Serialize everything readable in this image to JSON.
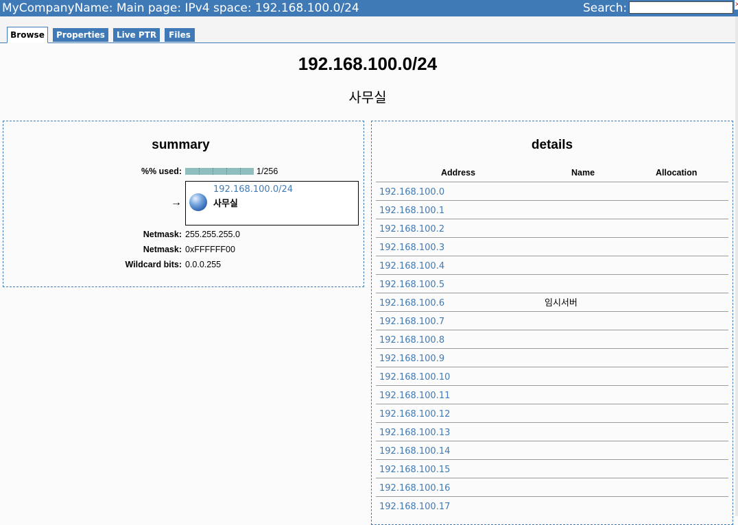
{
  "header": {
    "title": "MyCompanyName: Main page: IPv4 space: 192.168.100.0/24",
    "search_label": "Search:",
    "search_value": ""
  },
  "tabs": [
    {
      "label": "Browse",
      "active": true
    },
    {
      "label": "Properties",
      "active": false
    },
    {
      "label": "Live PTR",
      "active": false
    },
    {
      "label": "Files",
      "active": false
    }
  ],
  "page": {
    "title": "192.168.100.0/24",
    "subtitle": "사무실"
  },
  "summary": {
    "title": "summary",
    "used_label": "%% used:",
    "used_value": "1/256",
    "used_fraction": 0.0039,
    "network": {
      "arrow": "→",
      "prefix": "192.168.100.0/24",
      "name": "사무실",
      "icon": "globe-icon"
    },
    "fields": [
      {
        "label": "Netmask:",
        "value": "255.255.255.0"
      },
      {
        "label": "Netmask:",
        "value": "0xFFFFFF00"
      },
      {
        "label": "Wildcard bits:",
        "value": "0.0.0.255"
      }
    ]
  },
  "details": {
    "title": "details",
    "columns": [
      "Address",
      "Name",
      "Allocation"
    ],
    "rows": [
      {
        "address": "192.168.100.0",
        "name": "",
        "allocation": ""
      },
      {
        "address": "192.168.100.1",
        "name": "",
        "allocation": ""
      },
      {
        "address": "192.168.100.2",
        "name": "",
        "allocation": ""
      },
      {
        "address": "192.168.100.3",
        "name": "",
        "allocation": ""
      },
      {
        "address": "192.168.100.4",
        "name": "",
        "allocation": ""
      },
      {
        "address": "192.168.100.5",
        "name": "",
        "allocation": ""
      },
      {
        "address": "192.168.100.6",
        "name": "임시서버",
        "allocation": ""
      },
      {
        "address": "192.168.100.7",
        "name": "",
        "allocation": ""
      },
      {
        "address": "192.168.100.8",
        "name": "",
        "allocation": ""
      },
      {
        "address": "192.168.100.9",
        "name": "",
        "allocation": ""
      },
      {
        "address": "192.168.100.10",
        "name": "",
        "allocation": ""
      },
      {
        "address": "192.168.100.11",
        "name": "",
        "allocation": ""
      },
      {
        "address": "192.168.100.12",
        "name": "",
        "allocation": ""
      },
      {
        "address": "192.168.100.13",
        "name": "",
        "allocation": ""
      },
      {
        "address": "192.168.100.14",
        "name": "",
        "allocation": ""
      },
      {
        "address": "192.168.100.15",
        "name": "",
        "allocation": ""
      },
      {
        "address": "192.168.100.16",
        "name": "",
        "allocation": ""
      },
      {
        "address": "192.168.100.17",
        "name": "",
        "allocation": ""
      }
    ]
  },
  "colors": {
    "accent": "#3f7ab6",
    "usage_bar": "#8fbebe"
  }
}
